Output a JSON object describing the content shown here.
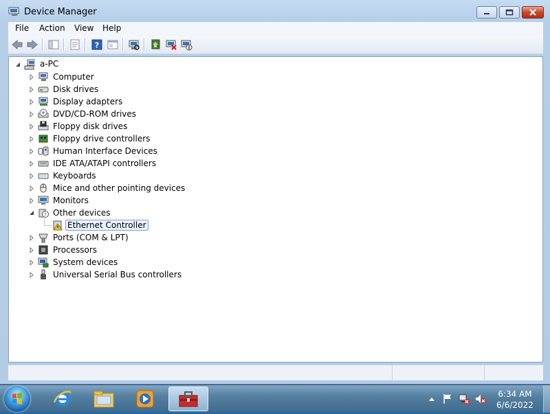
{
  "window": {
    "title": "Device Manager",
    "menu": [
      "File",
      "Action",
      "View",
      "Help"
    ],
    "toolbar_icons": [
      "back-arrow-icon",
      "forward-arrow-icon",
      "show-hide-tree-icon",
      "properties-icon",
      "help-icon",
      "view-icon",
      "scan-hardware-icon",
      "update-driver-icon",
      "uninstall-icon",
      "disable-icon"
    ]
  },
  "tree": {
    "root": "a-PC",
    "categories": [
      {
        "label": "Computer",
        "icon": "computer-icon",
        "expanded": false
      },
      {
        "label": "Disk drives",
        "icon": "disk-drive-icon",
        "expanded": false
      },
      {
        "label": "Display adapters",
        "icon": "display-adapter-icon",
        "expanded": false
      },
      {
        "label": "DVD/CD-ROM drives",
        "icon": "dvd-drive-icon",
        "expanded": false
      },
      {
        "label": "Floppy disk drives",
        "icon": "floppy-disk-icon",
        "expanded": false
      },
      {
        "label": "Floppy drive controllers",
        "icon": "floppy-controller-icon",
        "expanded": false
      },
      {
        "label": "Human Interface Devices",
        "icon": "hid-icon",
        "expanded": false
      },
      {
        "label": "IDE ATA/ATAPI controllers",
        "icon": "ide-controller-icon",
        "expanded": false
      },
      {
        "label": "Keyboards",
        "icon": "keyboard-icon",
        "expanded": false
      },
      {
        "label": "Mice and other pointing devices",
        "icon": "mouse-icon",
        "expanded": false
      },
      {
        "label": "Monitors",
        "icon": "monitor-icon",
        "expanded": false
      },
      {
        "label": "Other devices",
        "icon": "unknown-device-icon",
        "expanded": true,
        "children": [
          {
            "label": "Ethernet Controller",
            "icon": "warning-device-icon",
            "selected": true
          }
        ]
      },
      {
        "label": "Ports (COM & LPT)",
        "icon": "port-icon",
        "expanded": false
      },
      {
        "label": "Processors",
        "icon": "processor-icon",
        "expanded": false
      },
      {
        "label": "System devices",
        "icon": "system-device-icon",
        "expanded": false
      },
      {
        "label": "Universal Serial Bus controllers",
        "icon": "usb-icon",
        "expanded": false
      }
    ]
  },
  "taskbar": {
    "apps": [
      "internet-explorer-icon",
      "windows-explorer-icon",
      "media-player-icon",
      "device-manager-toolbox-icon"
    ],
    "active_app": "device-manager-toolbox-icon",
    "tray_icons": [
      "show-hidden-icons-icon",
      "action-center-flag-icon",
      "network-error-icon",
      "volume-muted-icon"
    ],
    "time": "6:34 AM",
    "date": "6/6/2022"
  },
  "colors": {
    "selection_border": "#7da2ce",
    "taskbar": "#55809f",
    "window_frame": "#b6cfe9"
  }
}
